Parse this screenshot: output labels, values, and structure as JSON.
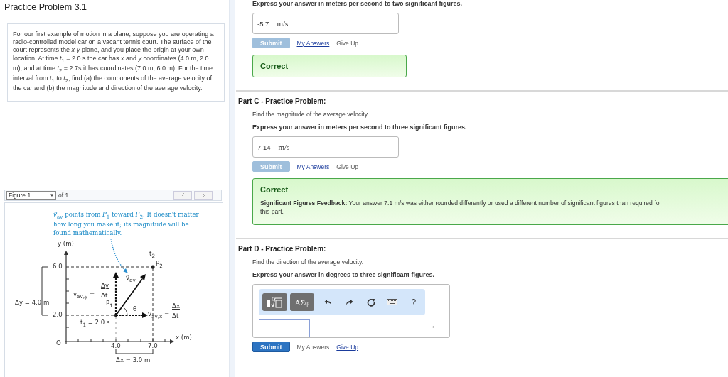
{
  "problem": {
    "title": "Practice Problem 3.1",
    "statement": "For our first example of motion in a plane, suppose you are operating a radio-controlled model car on a vacant tennis court. The surface of the court represents the *x*-*y* plane, and you place the origin at your own location. At time *t*$_{1}$ = 2.0 s the car has *x* and *y* coordinates (4.0 m, 2.0 m), and at time *t*$_{2}$ = 2.7s it has coordinates (7.0 m, 6.0 m). For the time interval from *t*$_{1}$ to *t*$_{2}$, find (a) the components of the average velocity of the car and (b) the magnitude and direction of the average velocity."
  },
  "figure": {
    "selector": "Figure 1",
    "selector_caret": "▼",
    "count": "of 1",
    "caption": "*v⃗*$_{av}$ points from *P*$_{1}$ toward *P*$_{2}$. It doesn't matter how long you make it; its magnitude will be found mathematically.",
    "labels": [
      {
        "kind": "y_axis",
        "text": "y (m)"
      },
      {
        "kind": "t2",
        "text": "t$_{2}$"
      },
      {
        "kind": "p2",
        "text": "P$_{2}$"
      },
      {
        "kind": "y_high",
        "text": "6.0"
      },
      {
        "kind": "vav",
        "text": "v⃗$_{av}$"
      },
      {
        "kind": "vy_num",
        "text": "Δy"
      },
      {
        "kind": "vy",
        "text": "v$_{av,y}$ ="
      },
      {
        "kind": "vy_den",
        "text": "Δt"
      },
      {
        "kind": "dy",
        "text": "Δy = 4.0 m"
      },
      {
        "kind": "p1",
        "text": "P$_{1}$"
      },
      {
        "kind": "vx_num",
        "text": "Δx"
      },
      {
        "kind": "theta",
        "text": "θ"
      },
      {
        "kind": "y_low",
        "text": "2.0"
      },
      {
        "kind": "vx",
        "text": "v$_{av,x}$ ="
      },
      {
        "kind": "vx_den",
        "text": "Δt"
      },
      {
        "kind": "t1",
        "text": "t$_{1}$ = 2.0 s"
      },
      {
        "kind": "x_axis",
        "text": "x (m)"
      },
      {
        "kind": "origin",
        "text": "O"
      },
      {
        "kind": "x_low",
        "text": "4.0"
      },
      {
        "kind": "x_high",
        "text": "7.0"
      },
      {
        "kind": "dx",
        "text": "Δx = 3.0 m"
      }
    ]
  },
  "parts": [
    {
      "kind": "answered",
      "instruction": "Express your answer in meters per second to two significant figures.",
      "answer": {
        "value": "-5.7",
        "unit": "m/s"
      },
      "submit": {
        "label": "Submit",
        "disabled": true
      },
      "links": [
        {
          "label": "My Answers",
          "enabled": true
        },
        {
          "label": "Give Up",
          "enabled": false
        }
      ],
      "feedback": {
        "title": "Correct"
      }
    },
    {
      "kind": "answered",
      "header": "Part C - Practice Problem:",
      "prompt": "Find the magnitude of the average velocity.",
      "instruction": "Express your answer in meters per second to three significant figures.",
      "answer": {
        "value": "7.14",
        "unit": "m/s"
      },
      "submit": {
        "label": "Submit",
        "disabled": true
      },
      "links": [
        {
          "label": "My Answers",
          "enabled": true
        },
        {
          "label": "Give Up",
          "enabled": false
        }
      ],
      "feedback": {
        "title": "Correct",
        "lines": [
          "**Significant Figures Feedback:** Your answer 7.1 m/s was either rounded differently or used a different number of significant figures than required fo",
          "this part."
        ]
      }
    },
    {
      "kind": "editor",
      "header": "Part D - Practice Problem:",
      "prompt": "Find the direction of the average velocity.",
      "instruction": "Express your answer in degrees to three significant figures.",
      "toolbar": [
        {
          "kind": "template"
        },
        {
          "kind": "symbols",
          "label": "ΑΣφ"
        },
        {
          "kind": "undo"
        },
        {
          "kind": "redo"
        },
        {
          "kind": "reset"
        },
        {
          "kind": "keyboard"
        },
        {
          "kind": "help",
          "label": "?"
        }
      ],
      "unit": "°",
      "submit": {
        "label": "Submit",
        "disabled": false
      },
      "links": [
        {
          "label": "My Answers",
          "enabled": false
        },
        {
          "label": "Give Up",
          "enabled": true
        }
      ]
    }
  ]
}
